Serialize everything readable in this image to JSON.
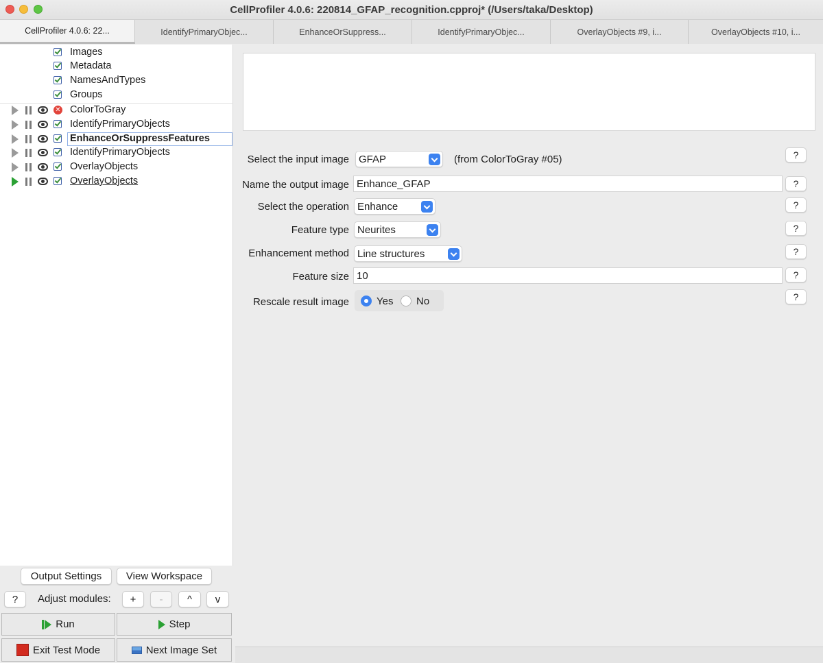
{
  "window": {
    "title": "CellProfiler 4.0.6: 220814_GFAP_recognition.cpproj* (/Users/taka/Desktop)"
  },
  "tabs": [
    {
      "label": "CellProfiler 4.0.6: 22..."
    },
    {
      "label": "IdentifyPrimaryObjec..."
    },
    {
      "label": "EnhanceOrSuppress..."
    },
    {
      "label": "IdentifyPrimaryObjec..."
    },
    {
      "label": "OverlayObjects #9, i..."
    },
    {
      "label": "OverlayObjects #10, i..."
    }
  ],
  "pipeline": {
    "input_modules": [
      {
        "label": "Images"
      },
      {
        "label": "Metadata"
      },
      {
        "label": "NamesAndTypes"
      },
      {
        "label": "Groups"
      }
    ],
    "modules": [
      {
        "label": "ColorToGray",
        "status": "error"
      },
      {
        "label": "IdentifyPrimaryObjects",
        "status": "ok"
      },
      {
        "label": "EnhanceOrSuppressFeatures",
        "status": "ok",
        "selected": true
      },
      {
        "label": "IdentifyPrimaryObjects",
        "status": "ok"
      },
      {
        "label": "OverlayObjects",
        "status": "ok"
      },
      {
        "label": "OverlayObjects",
        "status": "ok",
        "current": true
      }
    ]
  },
  "controls": {
    "output_settings": "Output Settings",
    "view_workspace": "View Workspace",
    "help": "?",
    "adjust_label": "Adjust modules:",
    "add": "+",
    "remove": "-",
    "up": "^",
    "down": "v",
    "run": "Run",
    "step": "Step",
    "exit_test_mode": "Exit Test Mode",
    "next_image_set": "Next Image Set"
  },
  "settings": {
    "input_image": {
      "label": "Select the input image",
      "value": "GFAP",
      "note": "(from ColorToGray #05)"
    },
    "output_image": {
      "label": "Name the output image",
      "value": "Enhance_GFAP"
    },
    "operation": {
      "label": "Select the operation",
      "value": "Enhance"
    },
    "feature_type": {
      "label": "Feature type",
      "value": "Neurites"
    },
    "enhancement_method": {
      "label": "Enhancement method",
      "value": "Line structures"
    },
    "feature_size": {
      "label": "Feature size",
      "value": "10"
    },
    "rescale": {
      "label": "Rescale result image",
      "yes": "Yes",
      "no": "No",
      "selected": "Yes"
    },
    "help": "?"
  },
  "colors": {
    "accent": "#3c82f0",
    "run_green": "#2ba134",
    "error_red": "#e2443b",
    "stop_red": "#d22b1f"
  }
}
